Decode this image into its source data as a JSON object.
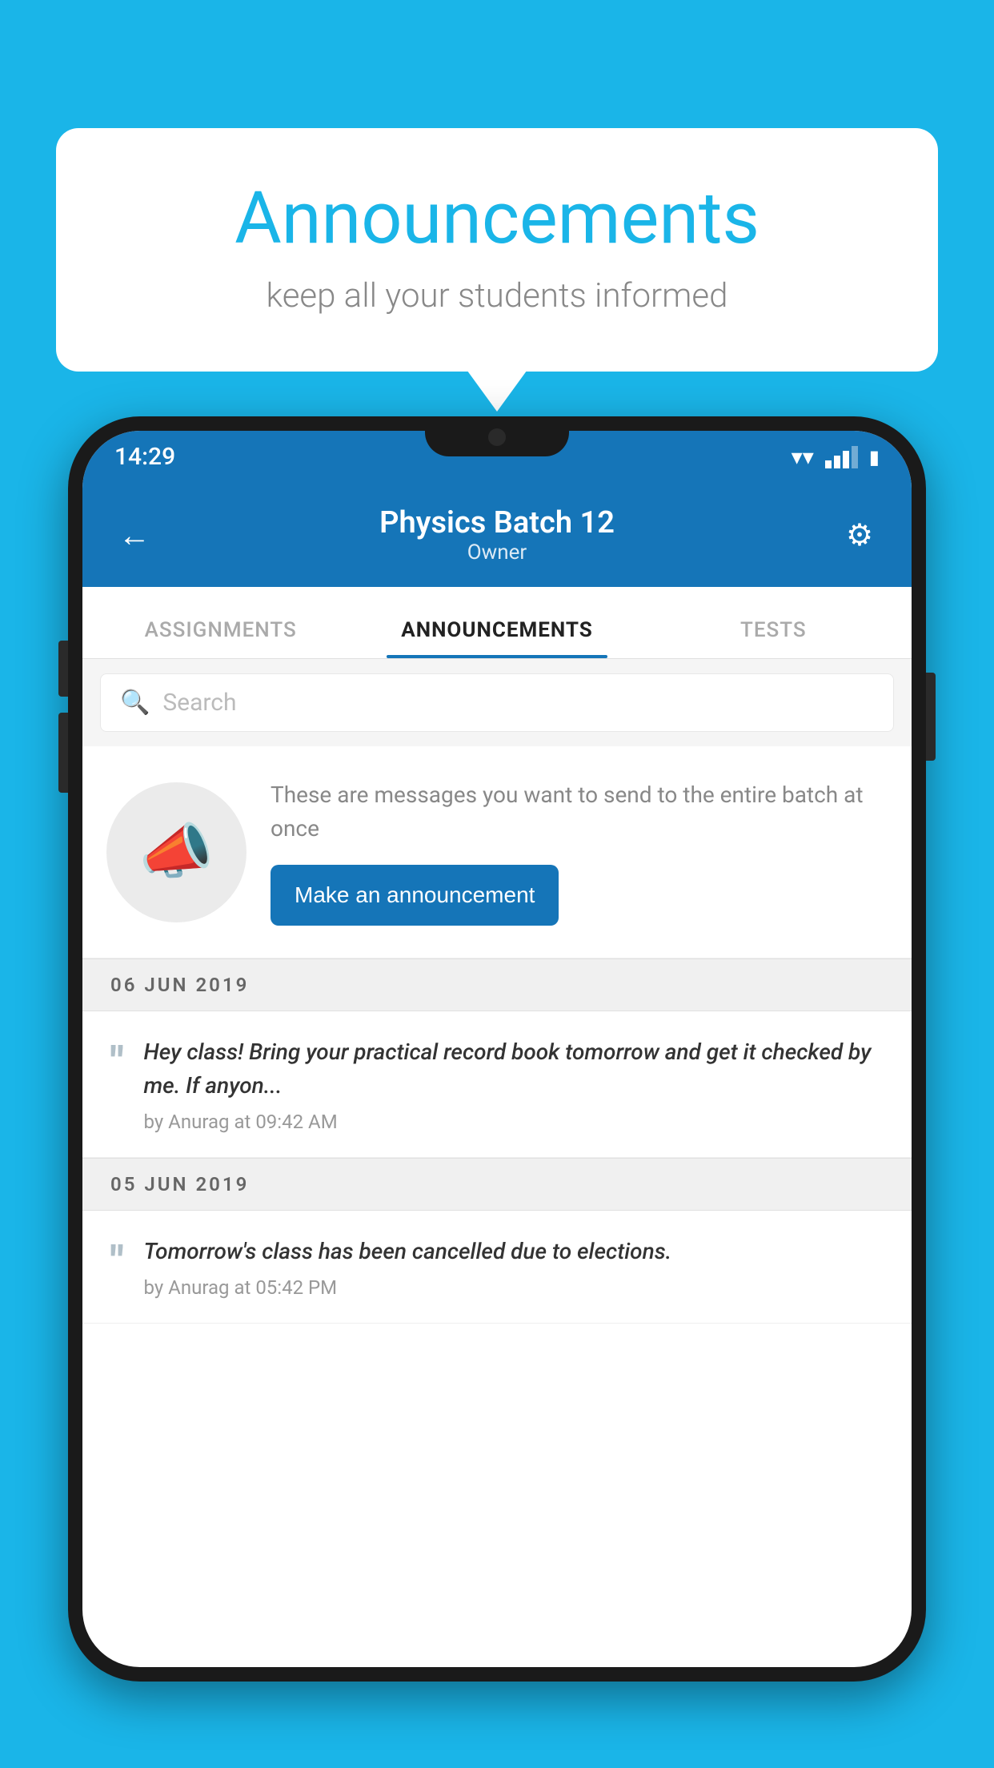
{
  "background_color": "#1ab5e8",
  "speech_bubble": {
    "title": "Announcements",
    "subtitle": "keep all your students informed"
  },
  "status_bar": {
    "time": "14:29"
  },
  "header": {
    "title": "Physics Batch 12",
    "subtitle": "Owner",
    "back_label": "←",
    "settings_label": "⚙"
  },
  "tabs": [
    {
      "label": "ASSIGNMENTS",
      "active": false
    },
    {
      "label": "ANNOUNCEMENTS",
      "active": true
    },
    {
      "label": "TESTS",
      "active": false
    }
  ],
  "search": {
    "placeholder": "Search"
  },
  "promo": {
    "description": "These are messages you want to send to the entire batch at once",
    "button_label": "Make an announcement"
  },
  "announcements": [
    {
      "date": "06  JUN  2019",
      "text": "Hey class! Bring your practical record book tomorrow and get it checked by me. If anyon...",
      "meta": "by Anurag at 09:42 AM"
    },
    {
      "date": "05  JUN  2019",
      "text": "Tomorrow's class has been cancelled due to elections.",
      "meta": "by Anurag at 05:42 PM"
    }
  ]
}
